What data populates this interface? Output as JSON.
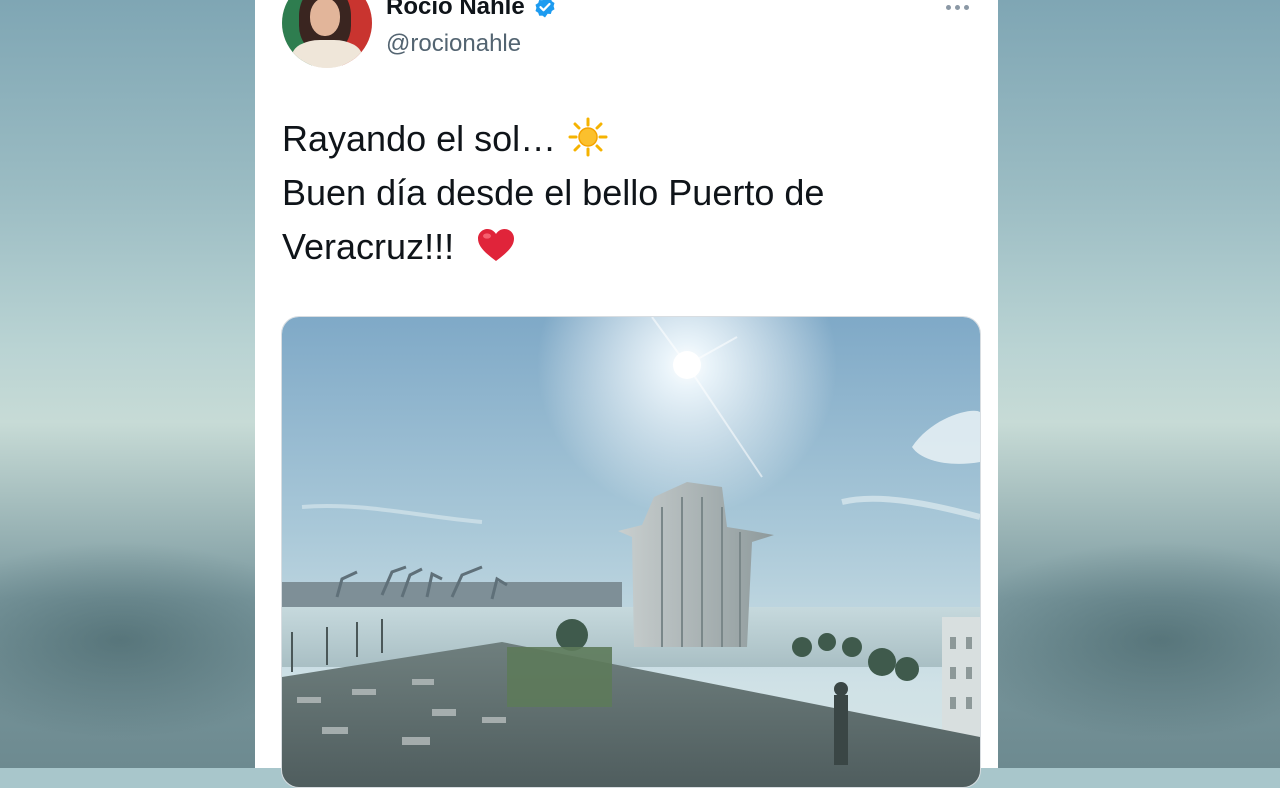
{
  "tweet": {
    "author": {
      "display_name": "Rocío Nahle",
      "handle": "@rocionahle",
      "verified": true,
      "avatar_icon": "avatar-photo"
    },
    "text_lines": [
      "Rayando el sol…",
      "Buen día desde el bello Puerto de",
      "Veracruz!!!"
    ],
    "emojis": [
      "sun-emoji",
      "red-heart-emoji"
    ],
    "media": {
      "type": "photo",
      "subject": "Veracruz port skyline with sun"
    },
    "more_menu_icon": "more-dots-icon"
  },
  "colors": {
    "verified_badge": "#1d9bf0",
    "text_primary": "#0f1419",
    "text_secondary": "#536471",
    "heart": "#e0243a"
  }
}
